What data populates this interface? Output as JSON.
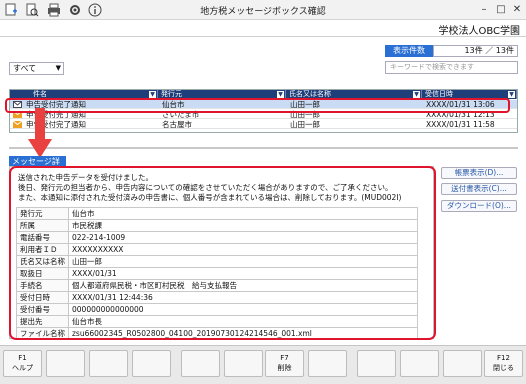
{
  "window": {
    "title": "地方税メッセージボックス確認",
    "org": "学校法人OBC学園"
  },
  "toolbar": {
    "icons": [
      "add-icon",
      "search-plus-icon",
      "print-icon",
      "settings-icon",
      "info-icon"
    ],
    "controls": [
      "minimize-icon",
      "maximize-icon",
      "close-icon"
    ]
  },
  "summary": {
    "count_label": "表示件数",
    "count_value": "13件 ／ 13件"
  },
  "search": {
    "placeholder": "キーワードで検索できます"
  },
  "filter": {
    "value": "すべて"
  },
  "list": {
    "columns": [
      "件名",
      "発行元",
      "氏名又は名称",
      "受信日時"
    ],
    "rows": [
      {
        "subject": "申告受付完了通知",
        "issuer": "仙台市",
        "name": "山田一郎",
        "received": "XXXX/01/31 13:06",
        "selected": true
      },
      {
        "subject": "申告受付完了通知",
        "issuer": "さいたま市",
        "name": "山田一郎",
        "received": "XXXX/01/31 12:13",
        "selected": false
      },
      {
        "subject": "申告受付完了通知",
        "issuer": "名古屋市",
        "name": "山田一郎",
        "received": "XXXX/01/31 11:58",
        "selected": false
      }
    ]
  },
  "detail": {
    "tab_label": "メッセージ詳細",
    "message_lines": [
      "送信された申告データを受付けました。",
      "後日、発行元の担当者から、申告内容についての確認をさせていただく場合がありますので、ご了承ください。",
      "また、本通知に添付された受付済みの申告書に、個人番号が含まれている場合は、削除しております。(MUD002I)"
    ],
    "fields": [
      {
        "key": "発行元",
        "value": "仙台市"
      },
      {
        "key": "所属",
        "value": "市民税課"
      },
      {
        "key": "電話番号",
        "value": "022-214-1009"
      },
      {
        "key": "利用者ＩＤ",
        "value": "XXXXXXXXXX"
      },
      {
        "key": "氏名又は名称",
        "value": "山田一郎"
      },
      {
        "key": "取扱日",
        "value": "XXXX/01/31"
      },
      {
        "key": "手続名",
        "value": "個人都道府県民税・市区町村民税　給与支払報告"
      },
      {
        "key": "受付日時",
        "value": "XXXX/01/31 12:44:36"
      },
      {
        "key": "受付番号",
        "value": "000000000000000"
      },
      {
        "key": "提出先",
        "value": "仙台市長"
      },
      {
        "key": "ファイル名称",
        "value": "zsu66002345_R0502800_04100_20190730124214546_001.xml"
      }
    ]
  },
  "side_buttons": [
    "帳票表示(D)...",
    "送付書表示(C)...",
    "ダウンロード(O)..."
  ],
  "fkeys": [
    {
      "key": "F1",
      "label": "ヘルプ"
    },
    {
      "key": "",
      "label": ""
    },
    {
      "key": "",
      "label": ""
    },
    {
      "key": "",
      "label": ""
    },
    {
      "key": "",
      "label": ""
    },
    {
      "key": "",
      "label": ""
    },
    {
      "key": "F7",
      "label": "削除"
    },
    {
      "key": "",
      "label": ""
    },
    {
      "key": "",
      "label": ""
    },
    {
      "key": "",
      "label": ""
    },
    {
      "key": "",
      "label": ""
    },
    {
      "key": "F12",
      "label": "閉じる"
    }
  ],
  "colors": {
    "accent": "#2a6fd3",
    "header": "#1e3f7a",
    "highlight": "#e0142c",
    "selected_row": "#c9dcf3"
  }
}
